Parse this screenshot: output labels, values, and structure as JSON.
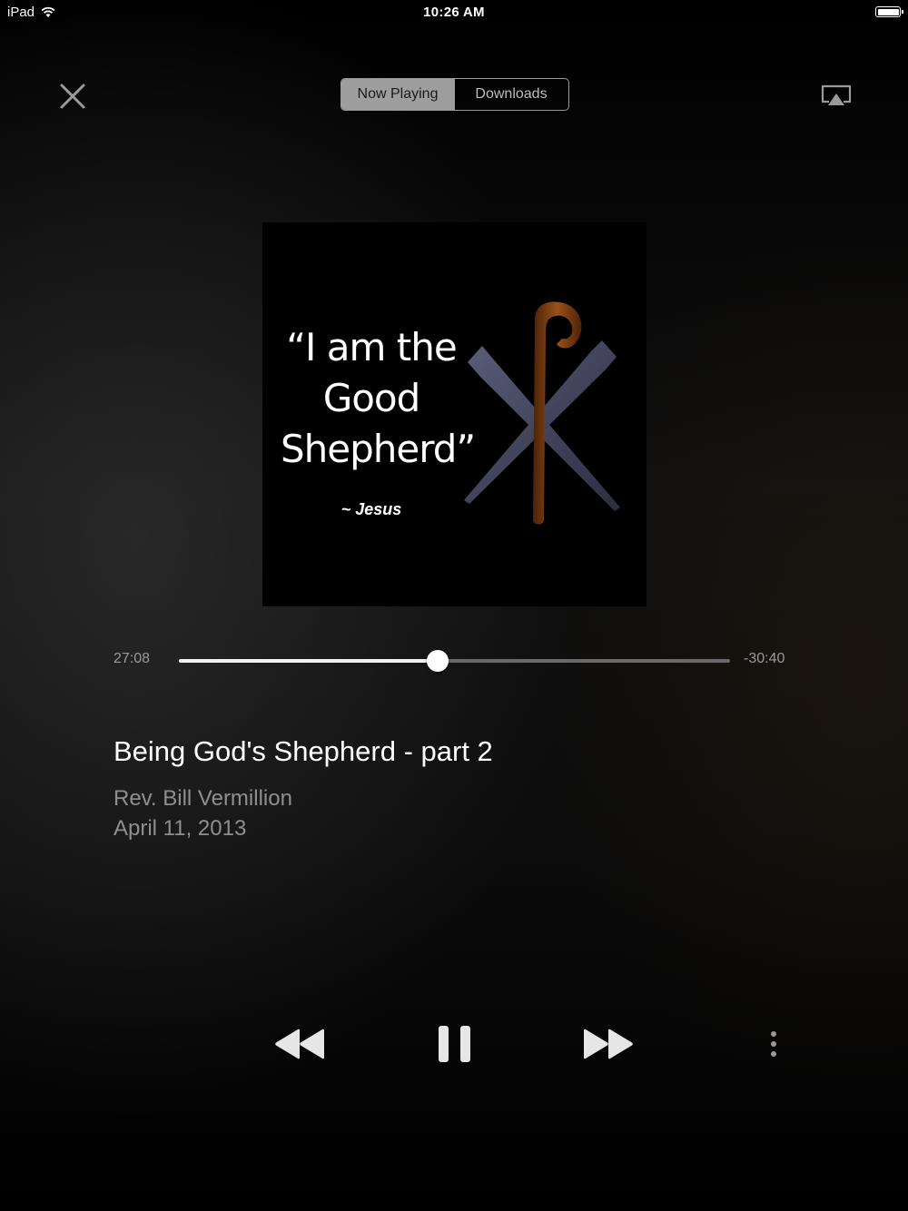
{
  "status_bar": {
    "device": "iPad",
    "time": "10:26 AM",
    "wifi_icon": "wifi-icon",
    "battery_icon": "battery-full-icon"
  },
  "header": {
    "close_icon": "close-icon",
    "tabs": [
      {
        "label": "Now Playing",
        "active": true
      },
      {
        "label": "Downloads",
        "active": false
      }
    ],
    "airplay_icon": "airplay-icon"
  },
  "artwork": {
    "quote_lines": [
      "“I am the",
      "Good",
      "Shepherd”"
    ],
    "attribution": "~ Jesus",
    "symbol": "shepherd-staff-and-nails-image"
  },
  "playback": {
    "elapsed": "27:08",
    "remaining": "-30:40",
    "progress": 0.47
  },
  "track": {
    "title": "Being God's Shepherd - part 2",
    "artist": "Rev. Bill Vermillion",
    "date": "April 11, 2013"
  },
  "controls": {
    "rewind_icon": "rewind-icon",
    "pause_icon": "pause-icon",
    "forward_icon": "fast-forward-icon",
    "more_icon": "more-vertical-icon"
  },
  "colors": {
    "background": "#0b0b0b",
    "segment_active": "#9e9e9e",
    "text_primary": "#ffffff",
    "text_secondary": "#8f8f8f",
    "staff": "#7a3d12",
    "nails": "#3d3f58"
  }
}
